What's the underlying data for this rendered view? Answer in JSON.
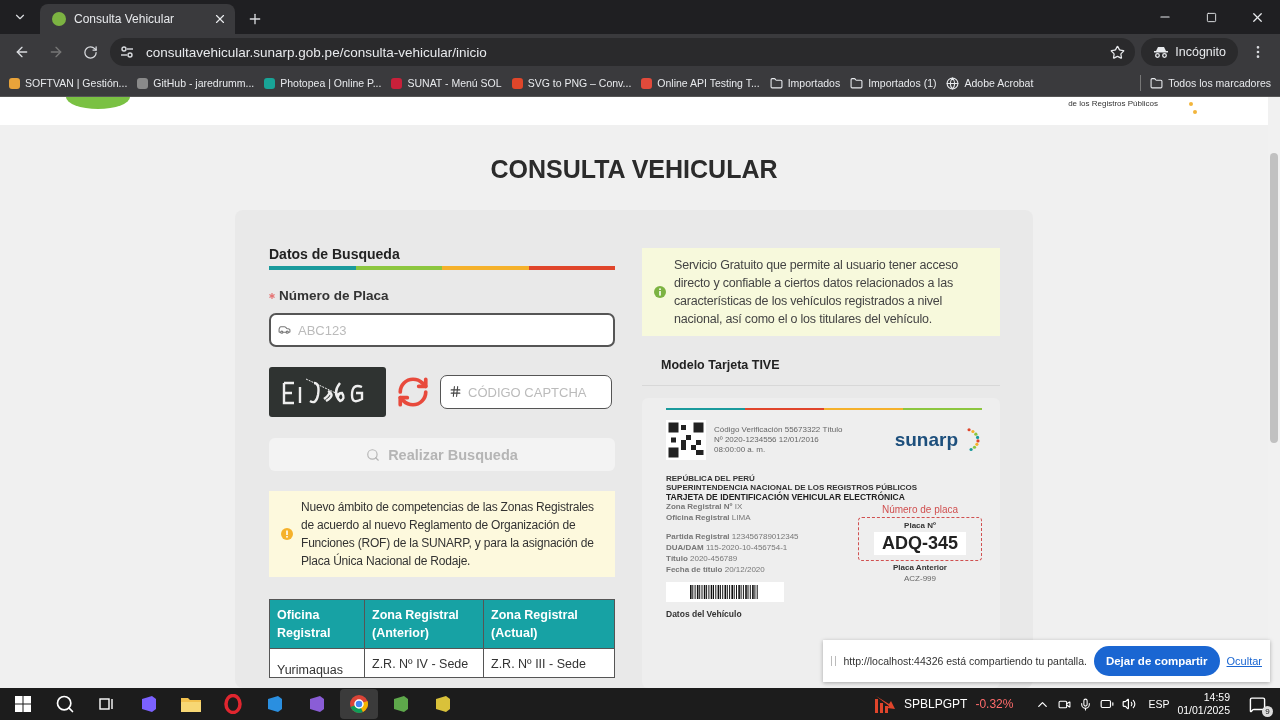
{
  "browser": {
    "tab_title": "Consulta Vehicular",
    "url": "consultavehicular.sunarp.gob.pe/consulta-vehicular/inicio",
    "profile": "Incógnito",
    "bookmarks": [
      {
        "kind": "site",
        "label": "SOFTVAN | Gestión...",
        "color": "#e8a33a"
      },
      {
        "kind": "site",
        "label": "GitHub - jaredrumm...",
        "color": "#8a8a8a"
      },
      {
        "kind": "site",
        "label": "Photopea | Online P...",
        "color": "#18a497"
      },
      {
        "kind": "site",
        "label": "SUNAT - Menú SOL",
        "color": "#c8203a"
      },
      {
        "kind": "site",
        "label": "SVG to PNG – Conv...",
        "color": "#e0462a"
      },
      {
        "kind": "site",
        "label": "Online API Testing T...",
        "color": "#e24a3b"
      },
      {
        "kind": "folder",
        "label": "Importados"
      },
      {
        "kind": "folder",
        "label": "Importados (1)"
      },
      {
        "kind": "globe",
        "label": "Adobe Acrobat"
      }
    ],
    "all_bookmarks": "Todos los marcadores"
  },
  "header": {
    "registry_text": "de los Registros Públicos"
  },
  "title": "CONSULTA VEHICULAR",
  "form": {
    "section_title": "Datos de Busqueda",
    "plate_label": "Número de Placa",
    "plate_placeholder": "ABC123",
    "captcha_placeholder": "CÓDIGO CAPTCHA",
    "search_button": "Realizar Busqueda",
    "search_disabled": true,
    "notice": "Nuevo ámbito de competencias de las Zonas Registrales de acuerdo al nuevo Reglamento de Organización de Funciones (ROF) de la SUNARP, y para la asignación de Placa Única Nacional de Rodaje.",
    "table": {
      "columns": [
        "Oficina Registral",
        "Zona Registral (Anterior)",
        "Zona Registral (Actual)"
      ],
      "rows": [
        [
          "Yurimaquas",
          "Z.R. Nº IV - Sede",
          "Z.R. Nº III - Sede"
        ]
      ]
    }
  },
  "info": {
    "text": "Servicio Gratuito que permite al usuario tener acceso directo y confiable a ciertos datos relacionados a las características de los vehículos registrados a nivel nacional, así como el o los titulares del vehículo.",
    "card_title": "Modelo Tarjeta TIVE"
  },
  "tive": {
    "verification": "Código Verificación 55673322 Título Nº 2020-1234556 12/01/2016 08:00:00 a. m.",
    "logo": "sunarp",
    "country": "REPÚBLICA DEL PERÚ",
    "agency": "SUPERINTENDENCIA NACIONAL DE LOS REGISTROS PÚBLICOS",
    "doc_title": "TARJETA DE IDENTIFICACIÓN VEHICULAR ELECTRÓNICA",
    "top_fields": [
      {
        "label": "Zona Registral Nº",
        "value": "IX"
      },
      {
        "label": "Oficina Registral",
        "value": "LIMA"
      }
    ],
    "fields": [
      {
        "label": "Partida Registral",
        "value": "123456789012345"
      },
      {
        "label": "DUA/DAM",
        "value": "115-2020-10-456754-1"
      },
      {
        "label": "Título",
        "value": "2020-456789"
      },
      {
        "label": "Fecha de título",
        "value": "20/12/2020"
      }
    ],
    "plate_callout": "Número de placa",
    "plate_label": "Placa Nº",
    "plate": "ADQ-345",
    "previous_label": "Placa Anterior",
    "previous": "ACZ-999",
    "section": "Datos del Vehículo"
  },
  "share_bar": {
    "message": "http://localhost:44326 está compartiendo tu pantalla.",
    "stop": "Dejar de compartir",
    "hide": "Ocultar"
  },
  "taskbar": {
    "apps": [
      {
        "kind": "copilot",
        "selected": false
      },
      {
        "kind": "explorer",
        "selected": false
      },
      {
        "kind": "opera",
        "selected": false
      },
      {
        "kind": "vscode",
        "selected": false
      },
      {
        "kind": "vstudio",
        "selected": false
      },
      {
        "kind": "chrome",
        "selected": true
      },
      {
        "kind": "notepad",
        "selected": false
      },
      {
        "kind": "tool",
        "selected": false
      }
    ],
    "ticker": "SPBLPGPT",
    "change": "-0.32%",
    "language": "ESP",
    "time": "14:59",
    "date": "01/01/2025",
    "notifications": "9"
  }
}
